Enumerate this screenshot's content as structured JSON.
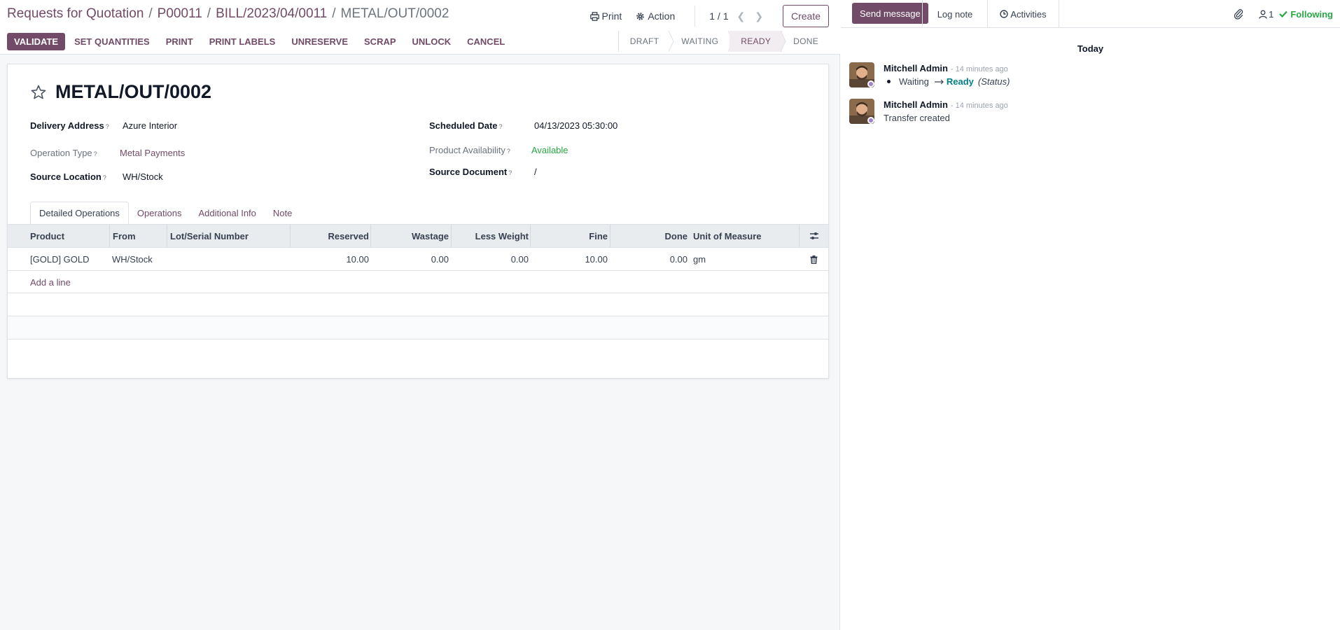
{
  "breadcrumb": {
    "items": [
      "Requests for Quotation",
      "P00011",
      "BILL/2023/04/0011"
    ],
    "current": "METAL/OUT/0002"
  },
  "topbar": {
    "print_label": "Print",
    "action_label": "Action",
    "pager": "1 / 1",
    "create_label": "Create"
  },
  "actions": {
    "validate": "VALIDATE",
    "buttons": [
      "SET QUANTITIES",
      "PRINT",
      "PRINT LABELS",
      "UNRESERVE",
      "SCRAP",
      "UNLOCK",
      "CANCEL"
    ]
  },
  "status": {
    "stages": [
      "DRAFT",
      "WAITING",
      "READY",
      "DONE"
    ],
    "active": "READY"
  },
  "form": {
    "title": "METAL/OUT/0002",
    "delivery_address": {
      "label": "Delivery Address",
      "value": "Azure Interior"
    },
    "operation_type": {
      "label": "Operation Type",
      "value": "Metal Payments"
    },
    "source_location": {
      "label": "Source Location",
      "value": "WH/Stock"
    },
    "scheduled_date": {
      "label": "Scheduled Date",
      "value": "04/13/2023 05:30:00"
    },
    "product_availability": {
      "label": "Product Availability",
      "value": "Available"
    },
    "source_document": {
      "label": "Source Document",
      "value": "/"
    },
    "help_mark": "?"
  },
  "tabs": [
    "Detailed Operations",
    "Operations",
    "Additional Info",
    "Note"
  ],
  "table": {
    "columns": [
      "Product",
      "From",
      "Lot/Serial Number",
      "Reserved",
      "Wastage",
      "Less Weight",
      "Fine",
      "Done",
      "Unit of Measure"
    ],
    "rows": [
      {
        "product": "[GOLD] GOLD",
        "from": "WH/Stock",
        "lot": "",
        "reserved": "10.00",
        "wastage": "0.00",
        "less_weight": "0.00",
        "fine": "10.00",
        "done": "0.00",
        "uom": "gm"
      }
    ],
    "add_line": "Add a line"
  },
  "chatter": {
    "send_message": "Send message",
    "log_note": "Log note",
    "activities": "Activities",
    "followers_count": "1",
    "following": "Following",
    "separator": "Today",
    "messages": [
      {
        "author": "Mitchell Admin",
        "date": "- 14 minutes ago",
        "old_value": "Waiting",
        "new_value": "Ready",
        "field": "(Status)"
      },
      {
        "author": "Mitchell Admin",
        "date": "- 14 minutes ago",
        "body": "Transfer created"
      }
    ]
  },
  "colors": {
    "brand": "#714b67",
    "success": "#28a745",
    "teal": "#017e84"
  }
}
